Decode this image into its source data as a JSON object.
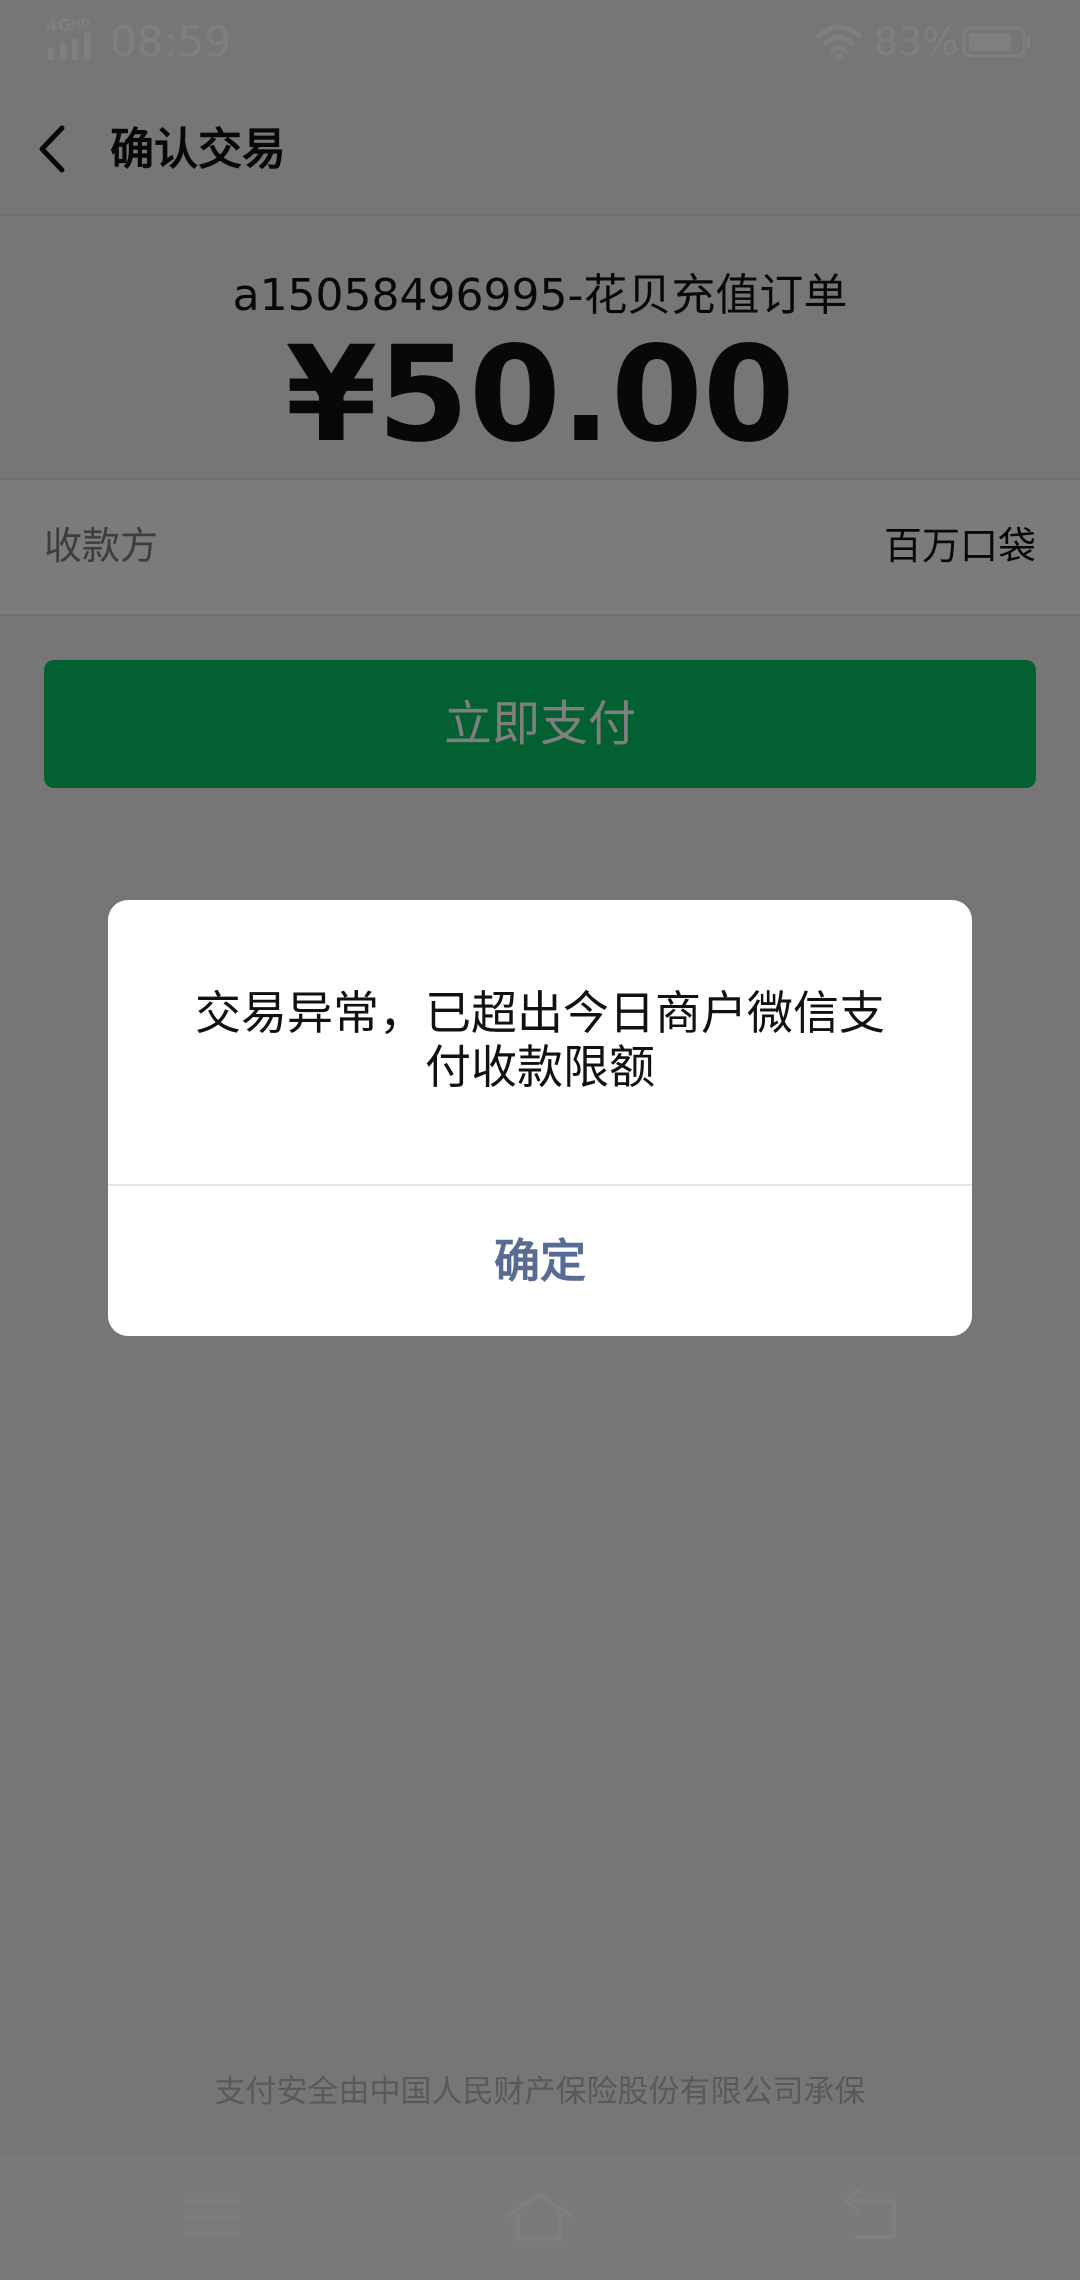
{
  "status_bar": {
    "network": "4G",
    "network_hd": "HD",
    "time": "08:59",
    "battery": "83%",
    "battery_level": 0.83,
    "icons": [
      "signal-icon",
      "wifi-icon",
      "battery-icon"
    ]
  },
  "nav": {
    "title": "确认交易",
    "back_icon": "chevron-left-icon"
  },
  "order": {
    "name": "a15058496995-花贝充值订单",
    "amount": "¥50.00"
  },
  "payee": {
    "label": "收款方",
    "value": "百万口袋"
  },
  "pay_button": {
    "label": "立即支付"
  },
  "footer": {
    "note": "支付安全由中国人民财产保险股份有限公司承保"
  },
  "dialog": {
    "message": "交易异常，已超出今日商户微信支付收款限额",
    "confirm_label": "确定"
  },
  "system_nav": {
    "icons": [
      "menu-icon",
      "home-icon",
      "back-icon"
    ]
  },
  "colors": {
    "brand_green": "#07c160",
    "link_blue": "#576b95",
    "overlay": "rgba(0,0,0,0.5)"
  }
}
